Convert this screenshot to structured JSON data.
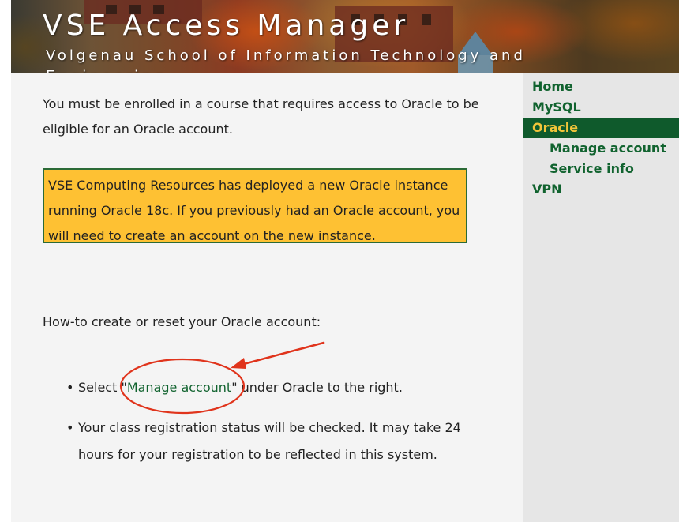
{
  "header": {
    "title": "VSE Access Manager",
    "subtitle": "Volgenau School of Information Technology and Engineering"
  },
  "main": {
    "intro": "You must be enrolled in a course that requires access to Oracle to be eligible for an Oracle account.",
    "notice": "VSE Computing Resources has deployed a new Oracle instance running Oracle 18c. If you previously had an Oracle account, you will need to create an account on the new instance.",
    "howto_heading": "How-to create or reset your Oracle account:",
    "steps": {
      "bullet": "•",
      "step1_prefix": "Select \"",
      "step1_link": "Manage account",
      "step1_suffix": "\" under Oracle to the right.",
      "step2": "Your class registration status will be checked. It may take 24 hours for your registration to be reflected in this system."
    }
  },
  "sidebar": {
    "items": [
      {
        "label": "Home"
      },
      {
        "label": "MySQL"
      },
      {
        "label": "Oracle"
      },
      {
        "label": "Manage account"
      },
      {
        "label": "Service info"
      },
      {
        "label": "VPN"
      }
    ]
  },
  "colors": {
    "link_green": "#11632f",
    "active_nav_bg": "#0f5a2c",
    "active_nav_text": "#f2c53a",
    "notice_bg": "#fec133",
    "notice_border": "#2b6a36",
    "annotation_red": "#e0341c"
  }
}
